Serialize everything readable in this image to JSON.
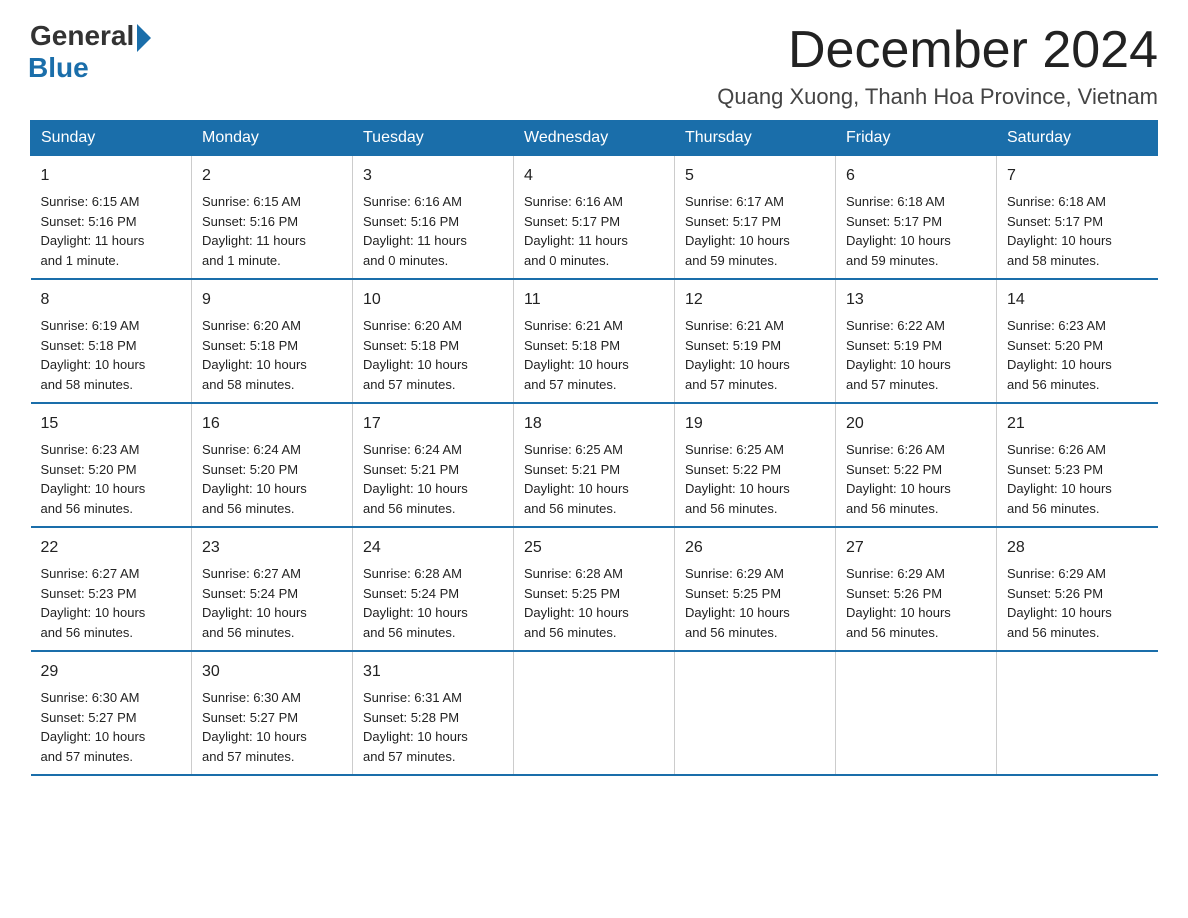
{
  "logo": {
    "general": "General",
    "blue": "Blue"
  },
  "title": "December 2024",
  "location": "Quang Xuong, Thanh Hoa Province, Vietnam",
  "days_header": [
    "Sunday",
    "Monday",
    "Tuesday",
    "Wednesday",
    "Thursday",
    "Friday",
    "Saturday"
  ],
  "weeks": [
    [
      {
        "day": "1",
        "sunrise": "6:15 AM",
        "sunset": "5:16 PM",
        "daylight": "11 hours and 1 minute."
      },
      {
        "day": "2",
        "sunrise": "6:15 AM",
        "sunset": "5:16 PM",
        "daylight": "11 hours and 1 minute."
      },
      {
        "day": "3",
        "sunrise": "6:16 AM",
        "sunset": "5:16 PM",
        "daylight": "11 hours and 0 minutes."
      },
      {
        "day": "4",
        "sunrise": "6:16 AM",
        "sunset": "5:17 PM",
        "daylight": "11 hours and 0 minutes."
      },
      {
        "day": "5",
        "sunrise": "6:17 AM",
        "sunset": "5:17 PM",
        "daylight": "10 hours and 59 minutes."
      },
      {
        "day": "6",
        "sunrise": "6:18 AM",
        "sunset": "5:17 PM",
        "daylight": "10 hours and 59 minutes."
      },
      {
        "day": "7",
        "sunrise": "6:18 AM",
        "sunset": "5:17 PM",
        "daylight": "10 hours and 58 minutes."
      }
    ],
    [
      {
        "day": "8",
        "sunrise": "6:19 AM",
        "sunset": "5:18 PM",
        "daylight": "10 hours and 58 minutes."
      },
      {
        "day": "9",
        "sunrise": "6:20 AM",
        "sunset": "5:18 PM",
        "daylight": "10 hours and 58 minutes."
      },
      {
        "day": "10",
        "sunrise": "6:20 AM",
        "sunset": "5:18 PM",
        "daylight": "10 hours and 57 minutes."
      },
      {
        "day": "11",
        "sunrise": "6:21 AM",
        "sunset": "5:18 PM",
        "daylight": "10 hours and 57 minutes."
      },
      {
        "day": "12",
        "sunrise": "6:21 AM",
        "sunset": "5:19 PM",
        "daylight": "10 hours and 57 minutes."
      },
      {
        "day": "13",
        "sunrise": "6:22 AM",
        "sunset": "5:19 PM",
        "daylight": "10 hours and 57 minutes."
      },
      {
        "day": "14",
        "sunrise": "6:23 AM",
        "sunset": "5:20 PM",
        "daylight": "10 hours and 56 minutes."
      }
    ],
    [
      {
        "day": "15",
        "sunrise": "6:23 AM",
        "sunset": "5:20 PM",
        "daylight": "10 hours and 56 minutes."
      },
      {
        "day": "16",
        "sunrise": "6:24 AM",
        "sunset": "5:20 PM",
        "daylight": "10 hours and 56 minutes."
      },
      {
        "day": "17",
        "sunrise": "6:24 AM",
        "sunset": "5:21 PM",
        "daylight": "10 hours and 56 minutes."
      },
      {
        "day": "18",
        "sunrise": "6:25 AM",
        "sunset": "5:21 PM",
        "daylight": "10 hours and 56 minutes."
      },
      {
        "day": "19",
        "sunrise": "6:25 AM",
        "sunset": "5:22 PM",
        "daylight": "10 hours and 56 minutes."
      },
      {
        "day": "20",
        "sunrise": "6:26 AM",
        "sunset": "5:22 PM",
        "daylight": "10 hours and 56 minutes."
      },
      {
        "day": "21",
        "sunrise": "6:26 AM",
        "sunset": "5:23 PM",
        "daylight": "10 hours and 56 minutes."
      }
    ],
    [
      {
        "day": "22",
        "sunrise": "6:27 AM",
        "sunset": "5:23 PM",
        "daylight": "10 hours and 56 minutes."
      },
      {
        "day": "23",
        "sunrise": "6:27 AM",
        "sunset": "5:24 PM",
        "daylight": "10 hours and 56 minutes."
      },
      {
        "day": "24",
        "sunrise": "6:28 AM",
        "sunset": "5:24 PM",
        "daylight": "10 hours and 56 minutes."
      },
      {
        "day": "25",
        "sunrise": "6:28 AM",
        "sunset": "5:25 PM",
        "daylight": "10 hours and 56 minutes."
      },
      {
        "day": "26",
        "sunrise": "6:29 AM",
        "sunset": "5:25 PM",
        "daylight": "10 hours and 56 minutes."
      },
      {
        "day": "27",
        "sunrise": "6:29 AM",
        "sunset": "5:26 PM",
        "daylight": "10 hours and 56 minutes."
      },
      {
        "day": "28",
        "sunrise": "6:29 AM",
        "sunset": "5:26 PM",
        "daylight": "10 hours and 56 minutes."
      }
    ],
    [
      {
        "day": "29",
        "sunrise": "6:30 AM",
        "sunset": "5:27 PM",
        "daylight": "10 hours and 57 minutes."
      },
      {
        "day": "30",
        "sunrise": "6:30 AM",
        "sunset": "5:27 PM",
        "daylight": "10 hours and 57 minutes."
      },
      {
        "day": "31",
        "sunrise": "6:31 AM",
        "sunset": "5:28 PM",
        "daylight": "10 hours and 57 minutes."
      },
      {
        "day": "",
        "sunrise": "",
        "sunset": "",
        "daylight": ""
      },
      {
        "day": "",
        "sunrise": "",
        "sunset": "",
        "daylight": ""
      },
      {
        "day": "",
        "sunrise": "",
        "sunset": "",
        "daylight": ""
      },
      {
        "day": "",
        "sunrise": "",
        "sunset": "",
        "daylight": ""
      }
    ]
  ],
  "labels": {
    "sunrise": "Sunrise:",
    "sunset": "Sunset:",
    "daylight": "Daylight:"
  }
}
